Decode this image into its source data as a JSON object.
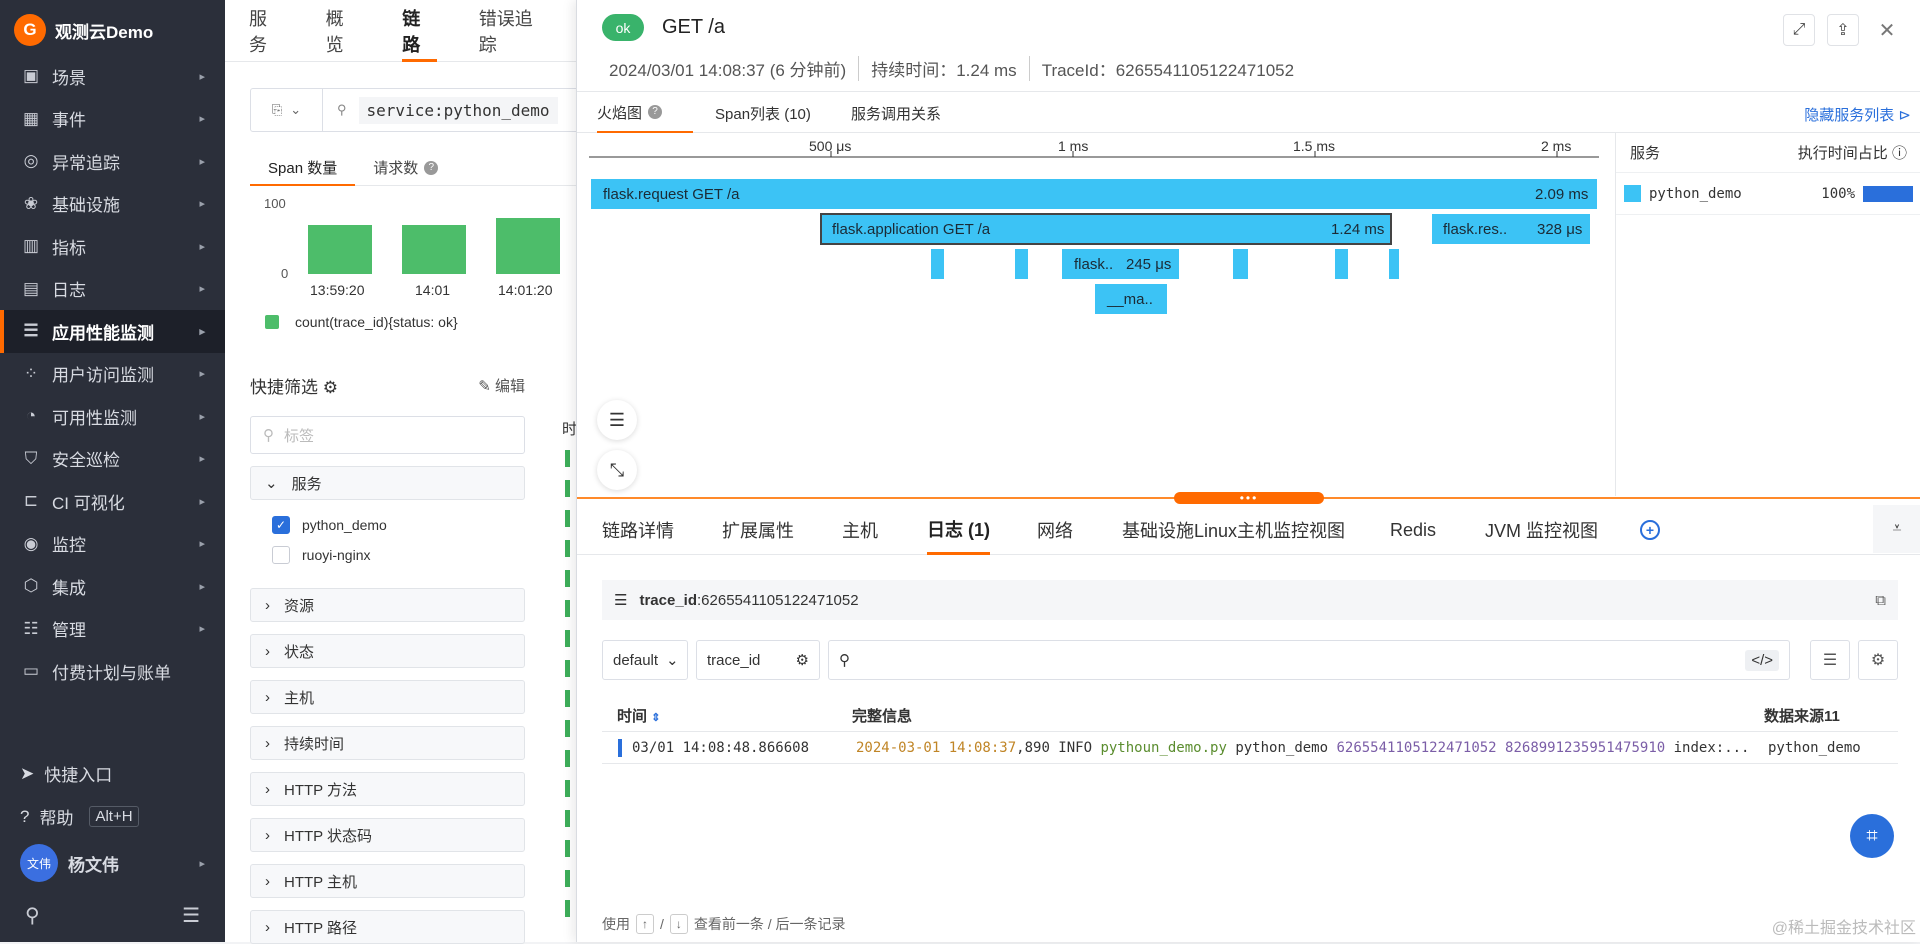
{
  "brand": {
    "logo_letter": "G",
    "name": "观测云Demo",
    "accent": "#ff6a00"
  },
  "sidebar": {
    "items": [
      {
        "label": "场景",
        "icon": "monitor-icon"
      },
      {
        "label": "事件",
        "icon": "calendar-icon"
      },
      {
        "label": "异常追踪",
        "icon": "bug-scan-icon"
      },
      {
        "label": "基础设施",
        "icon": "infra-icon"
      },
      {
        "label": "指标",
        "icon": "metrics-icon"
      },
      {
        "label": "日志",
        "icon": "log-icon"
      },
      {
        "label": "应用性能监测",
        "icon": "apm-icon"
      },
      {
        "label": "用户访问监测",
        "icon": "rum-icon"
      },
      {
        "label": "可用性监测",
        "icon": "dial-icon"
      },
      {
        "label": "安全巡检",
        "icon": "shield-icon"
      },
      {
        "label": "CI 可视化",
        "icon": "ci-icon"
      },
      {
        "label": "监控",
        "icon": "alarm-icon"
      },
      {
        "label": "集成",
        "icon": "box-icon"
      },
      {
        "label": "管理",
        "icon": "sliders-icon"
      },
      {
        "label": "付费计划与账单",
        "icon": "bill-icon"
      }
    ],
    "quick_entry": "快捷入口",
    "help": "帮助",
    "help_key": "Alt+H",
    "avatar_text": "文伟",
    "user_name": "杨文伟"
  },
  "topnav": {
    "tabs": [
      "服务",
      "概览",
      "链路",
      "错误追踪"
    ]
  },
  "search": {
    "query": "service:python_demo"
  },
  "metric_tabs": [
    "Span 数量",
    "请求数"
  ],
  "minichart": {
    "yticks": [
      "100",
      "0"
    ],
    "xticks": [
      "13:59:20",
      "14:01",
      "14:01:20"
    ],
    "legend": "count(trace_id){status: ok}",
    "color": "#4dbd6a"
  },
  "quick_filter": {
    "title": "快捷筛选",
    "edit": "编辑",
    "tag_placeholder": "标签",
    "groups": [
      "服务",
      "资源",
      "状态",
      "主机",
      "持续时间",
      "HTTP 方法",
      "HTTP 状态码",
      "HTTP 主机",
      "HTTP 路径"
    ],
    "service_options": [
      {
        "label": "python_demo",
        "checked": true
      },
      {
        "label": "ruoyi-nginx",
        "checked": false
      }
    ]
  },
  "list_peek_header": "时",
  "drawer": {
    "status": "ok",
    "title": "GET /a",
    "date": "2024/03/01 14:08:37 (6 分钟前)",
    "duration": "持续时间：1.24 ms",
    "trace_id": "TraceId：6265541105122471052",
    "tabs": [
      "火焰图",
      "Span列表 (10)",
      "服务调用关系"
    ],
    "hide_services": "隐藏服务列表",
    "axis_ticks": [
      "500 μs",
      "1 ms",
      "1.5 ms",
      "2 ms"
    ],
    "spans": {
      "root": {
        "name": "flask.request GET /a",
        "dur": "2.09 ms"
      },
      "app": {
        "name": "flask.application GET /a",
        "dur": "1.24 ms"
      },
      "res": {
        "name": "flask.res..",
        "dur": "328 μs"
      },
      "sub": {
        "name": "flask..",
        "dur": "245 μs"
      },
      "ma": {
        "name": "__ma.."
      }
    },
    "services_panel": {
      "col1": "服务",
      "col2": "执行时间占比",
      "row": {
        "name": "python_demo",
        "pct": "100%",
        "color": "#3cc3f5"
      }
    },
    "bottom_tabs": [
      "链路详情",
      "扩展属性",
      "主机",
      "日志 (1)",
      "网络",
      "基础设施Linux主机监控视图",
      "Redis",
      "JVM 监控视图"
    ],
    "filter": {
      "key": "trace_id",
      "value": ":6265541105122471052"
    },
    "log_controls": {
      "index": "default",
      "field": "trace_id"
    },
    "log_table": {
      "headers": [
        "时间",
        "完整信息",
        "数据来源11"
      ],
      "row": {
        "time": "03/01 14:08:48.866608",
        "msg_date": "2024-03-01 14:08:37",
        "msg_ms": ",890 INFO ",
        "msg_file": "pythoun_demo.py",
        "msg_svc": " python_demo ",
        "msg_trace": "6265541105122471052 8268991235951475910",
        "msg_tail": " index:...",
        "source": "python_demo"
      }
    },
    "hint": {
      "pre": "使用",
      "up": "↑",
      "sep": "/",
      "down": "↓",
      "post": "查看前一条 / 后一条记录"
    }
  },
  "watermark": "@稀土掘金技术社区"
}
